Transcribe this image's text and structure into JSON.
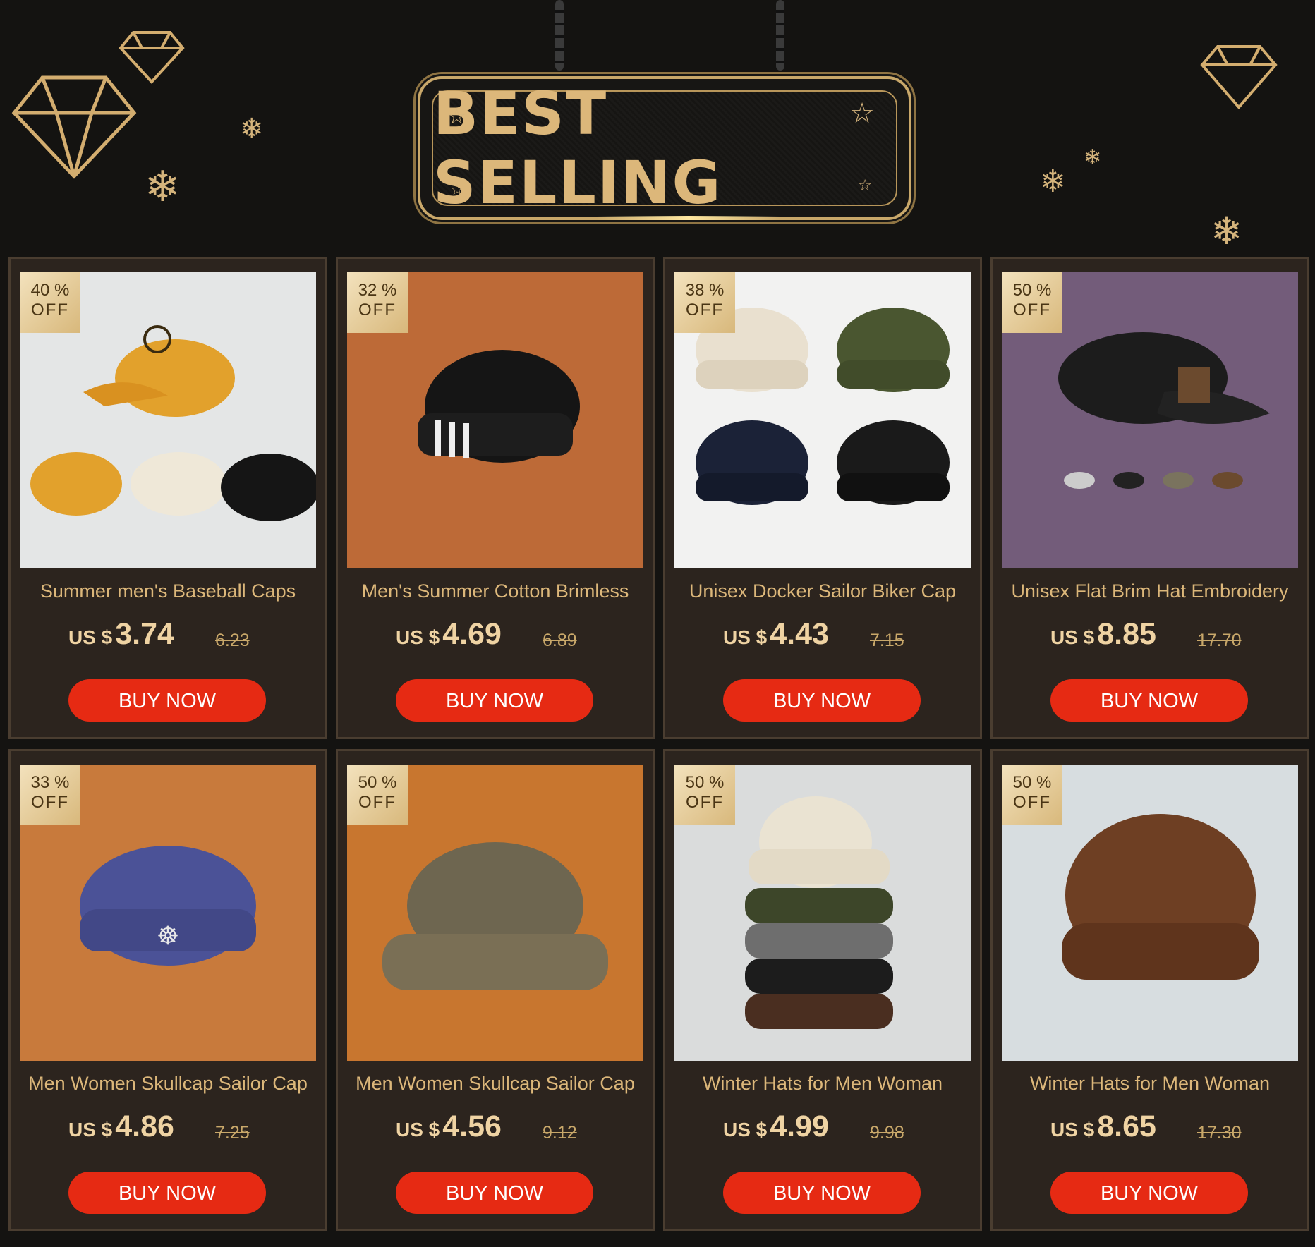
{
  "header": {
    "title": "BEST SELLING"
  },
  "badge_off": "OFF",
  "currency": "US $",
  "buy_label": "BUY NOW",
  "products": [
    {
      "discount": "40 %",
      "title": "Summer men's  Baseball Caps",
      "price": "3.74",
      "old_price": "6.23",
      "bg": "#e4e6e6"
    },
    {
      "discount": "32 %",
      "title": "Men's Summer Cotton Brimless",
      "price": "4.69",
      "old_price": "6.89",
      "bg": "#bd6a37"
    },
    {
      "discount": "38 %",
      "title": "Unisex Docker Sailor Biker Cap",
      "price": "4.43",
      "old_price": "7.15",
      "bg": "#f2f2f1"
    },
    {
      "discount": "50 %",
      "title": "Unisex Flat Brim Hat Embroidery",
      "price": "8.85",
      "old_price": "17.70",
      "bg": "#735c7a"
    },
    {
      "discount": "33 %",
      "title": "Men Women Skullcap Sailor Cap",
      "price": "4.86",
      "old_price": "7.25",
      "bg": "#c87a3c"
    },
    {
      "discount": "50 %",
      "title": "Men Women Skullcap Sailor Cap",
      "price": "4.56",
      "old_price": "9.12",
      "bg": "#c8762f"
    },
    {
      "discount": "50 %",
      "title": "Winter Hats for Men Woman",
      "price": "4.99",
      "old_price": "9.98",
      "bg": "#dadcdc"
    },
    {
      "discount": "50 %",
      "title": "Winter Hats for Men Woman",
      "price": "8.65",
      "old_price": "17.30",
      "bg": "#d7dde0"
    }
  ]
}
